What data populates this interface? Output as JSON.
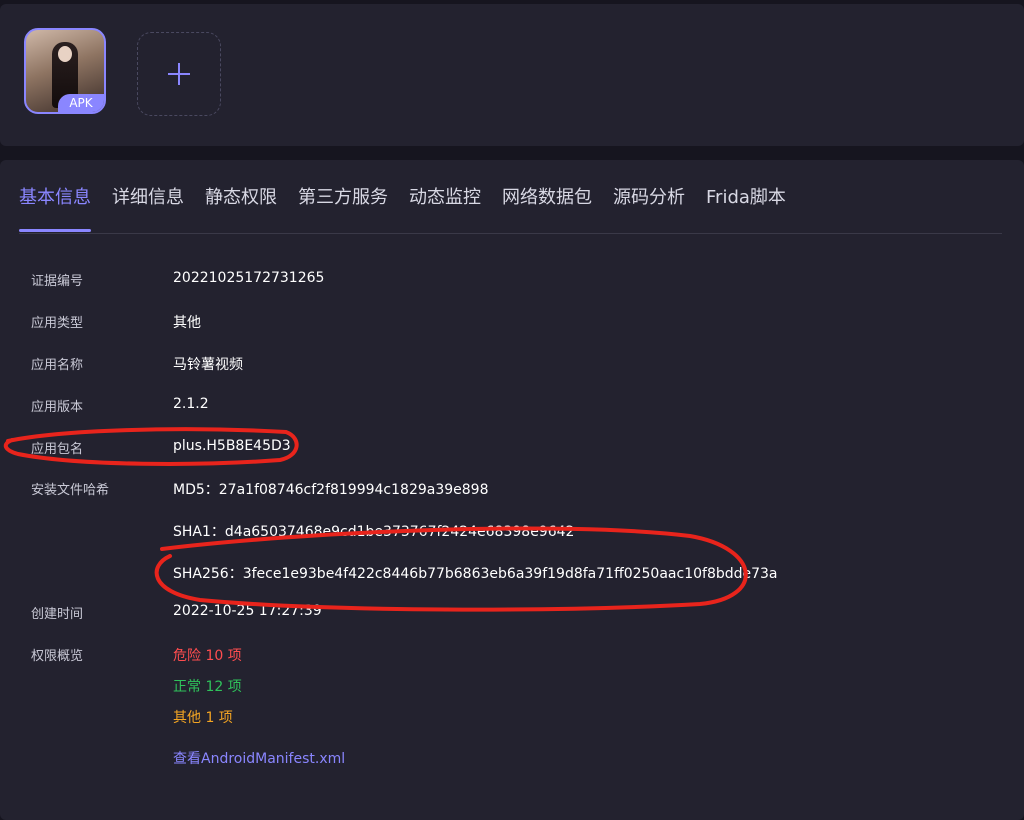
{
  "header": {
    "app_badge": "APK",
    "add_symbol": "+"
  },
  "tabs": [
    {
      "label": "基本信息"
    },
    {
      "label": "详细信息"
    },
    {
      "label": "静态权限"
    },
    {
      "label": "第三方服务"
    },
    {
      "label": "动态监控"
    },
    {
      "label": "网络数据包"
    },
    {
      "label": "源码分析"
    },
    {
      "label": "Frida脚本"
    }
  ],
  "info": {
    "report_id": {
      "label": "证据编号",
      "value": "20221025172731265"
    },
    "app_type": {
      "label": "应用类型",
      "value": "其他"
    },
    "app_name": {
      "label": "应用名称",
      "value": "马铃薯视频"
    },
    "app_version": {
      "label": "应用版本",
      "value": "2.1.2"
    },
    "package_name": {
      "label": "应用包名",
      "value": "plus.H5B8E45D3"
    },
    "hashes": {
      "label": "安装文件哈希",
      "md5": "MD5：27a1f08746cf2f819994c1829a39e898",
      "sha1": "SHA1：d4a65037468e9cd1be373767f2424e68398e9642",
      "sha256": "SHA256：3fece1e93be4f422c8446b77b6863eb6a39f19d8fa71ff0250aac10f8bdde73a"
    },
    "created_time": {
      "label": "创建时间",
      "value": "2022-10-25 17:27:39"
    },
    "permissions": {
      "label": "权限概览",
      "danger": "危险 10 项",
      "normal": "正常 12 项",
      "other": "其他 1 项",
      "manifest_link": "查看AndroidManifest.xml"
    }
  },
  "colors": {
    "accent": "#8a86ff",
    "danger": "#ff4d4f",
    "normal": "#2fc25b",
    "other": "#f5a623",
    "annotation": "#e8241c"
  }
}
